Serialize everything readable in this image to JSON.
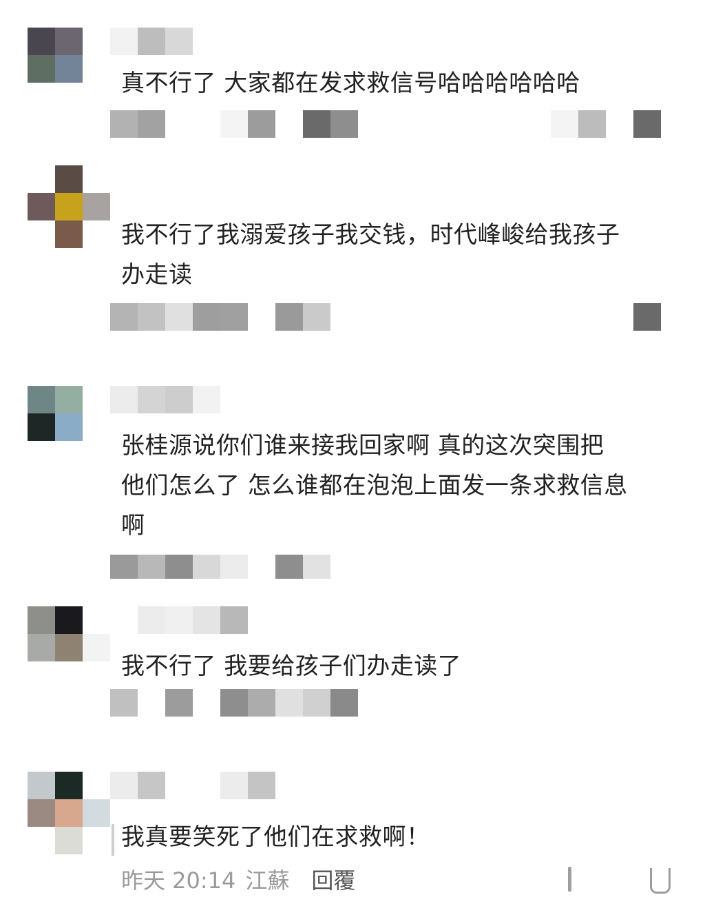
{
  "colors": {
    "background": "#ffffff",
    "comment_text": "#222222",
    "meta_text": "#9a9a9a",
    "reply_link": "#555555"
  },
  "comments": [
    {
      "author_obscured": true,
      "text": "真不行了 大家都在发求救信号哈哈哈哈哈哈"
    },
    {
      "author_obscured": true,
      "text": "我不行了我溺爱孩子我交钱，时代峰峻给我孩子\n办走读"
    },
    {
      "author_obscured": true,
      "text": "张桂源说你们谁来接我回家啊 真的这次突围把\n他们怎么了 怎么谁都在泡泡上面发一条求救信息\n啊"
    },
    {
      "author_obscured": true,
      "text": "我不行了 我要给孩子们办走读了"
    },
    {
      "author_obscured": true,
      "text": "我真要笑死了他们在求救啊！",
      "time": "昨天 20:14",
      "location": "江蘇",
      "reply_label": "回覆"
    }
  ],
  "icons": {
    "action_left": "bookmark-outline-icon",
    "action_right": "like-outline-icon"
  }
}
